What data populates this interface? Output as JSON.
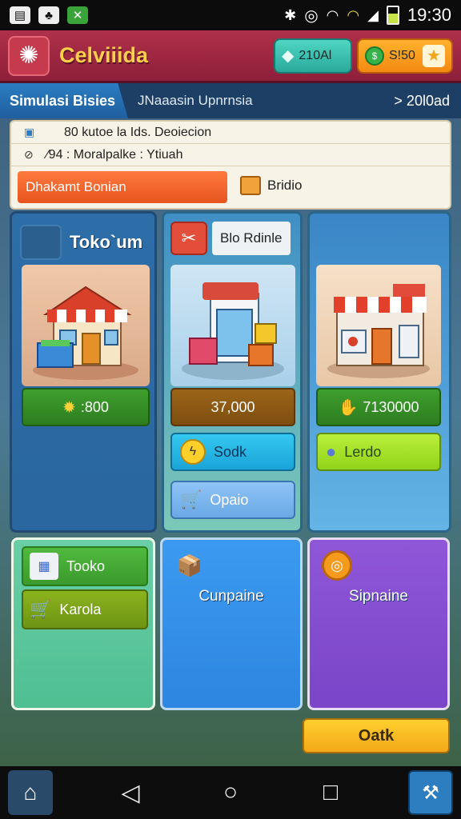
{
  "status_bar": {
    "time": "19:30",
    "left_icons": [
      "sim-card-icon",
      "gallery-icon",
      "game-icon"
    ],
    "right_icons": [
      "bluetooth-icon",
      "sync-icon",
      "wifi-icon",
      "wifi-icon",
      "signal-icon",
      "battery-icon"
    ]
  },
  "app": {
    "title": "Celviiida",
    "gems_value": "210Al",
    "coins_value": "S!50"
  },
  "tabs": {
    "active": "Simulasi Bisies",
    "subtitle": "JNaaasin Upnrnsia",
    "right": "> 20l0ad"
  },
  "info": {
    "row1": "80 kutoe la Ids. Deoiecion",
    "row2": "⁄94 : Moralpalke : Ytiuah",
    "promo": "Dhakamt Bonian",
    "tag": "Bridio"
  },
  "columns": [
    {
      "title": "Toko`um",
      "price": ":800"
    },
    {
      "chip": "Blo Rdinle",
      "price": "37,000",
      "pill1": "Sodk",
      "pill2": "Opaio"
    },
    {
      "price": "7130000",
      "pill1": "Lerdo"
    }
  ],
  "bottom": {
    "mini1": "Tooko",
    "mini2": "Karola",
    "blue_label": "Cunpaine",
    "purple_label": "Sipnaine",
    "action": "Oatk"
  },
  "colors": {
    "appbar": "#a82a44",
    "title": "#ffd04a",
    "tabbar": "#1d3f66",
    "accent_orange": "#e8541f"
  }
}
